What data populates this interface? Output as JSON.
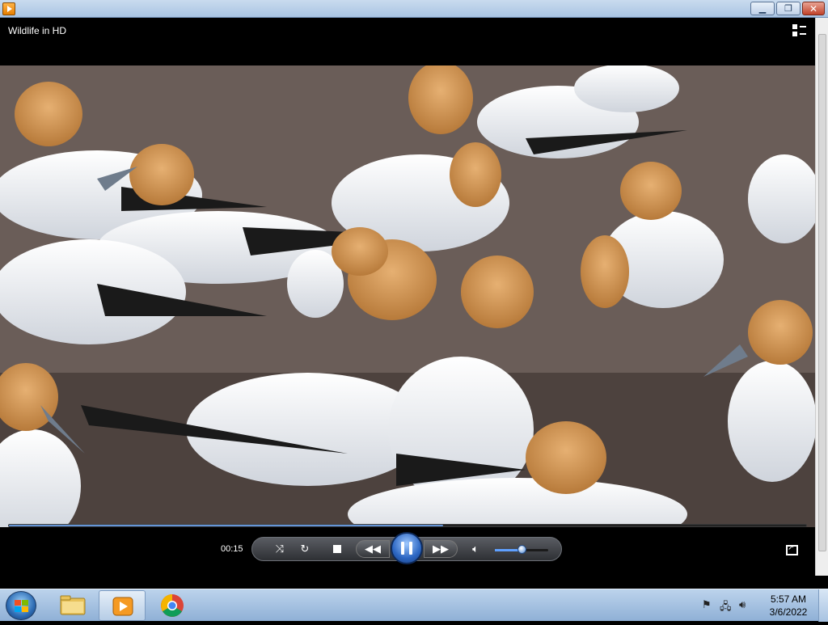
{
  "window": {
    "title": "Wildlife in HD"
  },
  "playback": {
    "elapsed": "00:15",
    "progress_fraction": 0.545,
    "volume_fraction": 0.5
  },
  "controls": {
    "shuffle_icon": "shuffle-icon",
    "repeat_icon": "repeat-icon",
    "stop_icon": "stop-icon",
    "previous_icon": "rewind-icon",
    "pause_icon": "pause-icon",
    "next_icon": "fast-forward-icon",
    "mute_icon": "speaker-icon",
    "switch_icon": "switch-to-library-icon",
    "fullscreen_icon": "fullscreen-icon"
  },
  "taskbar": {
    "clock_time": "5:57 AM",
    "clock_date": "3/6/2022",
    "pinned": [
      "start-button",
      "file-explorer",
      "windows-media-player",
      "chrome"
    ]
  },
  "colors": {
    "accent": "#3d74c4",
    "titlebar": "#a9c4e3",
    "taskbar": "#8fb0d6",
    "close": "#c1432a"
  }
}
